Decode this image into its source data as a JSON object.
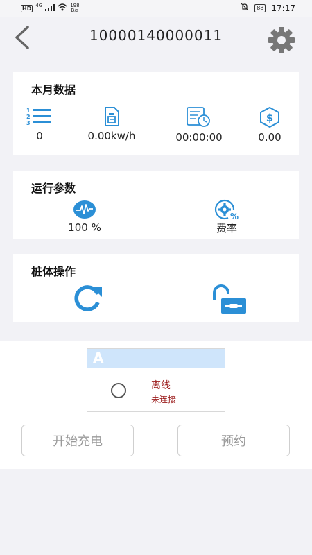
{
  "status_bar": {
    "hd": "HD",
    "net_type": "4G",
    "net_speed_value": "198",
    "net_speed_unit": "B/s",
    "battery": "88",
    "time": "17:17"
  },
  "header": {
    "title": "10000140000011"
  },
  "month_data": {
    "title": "本月数据",
    "count": "0",
    "energy": "0.00kw/h",
    "duration": "00:00:00",
    "amount": "0.00"
  },
  "run_params": {
    "title": "运行参数",
    "power_percent": "100 %",
    "rate_label": "费率"
  },
  "pile_ops": {
    "title": "桩体操作"
  },
  "gun": {
    "name": "A",
    "state": "离线",
    "sub_state": "未连接"
  },
  "actions": {
    "start_label": "开始充电",
    "reserve_label": "预约"
  },
  "colors": {
    "accent": "#2b8fd6",
    "offline": "#9b1b1b",
    "gun_header": "#cfe5fb"
  }
}
